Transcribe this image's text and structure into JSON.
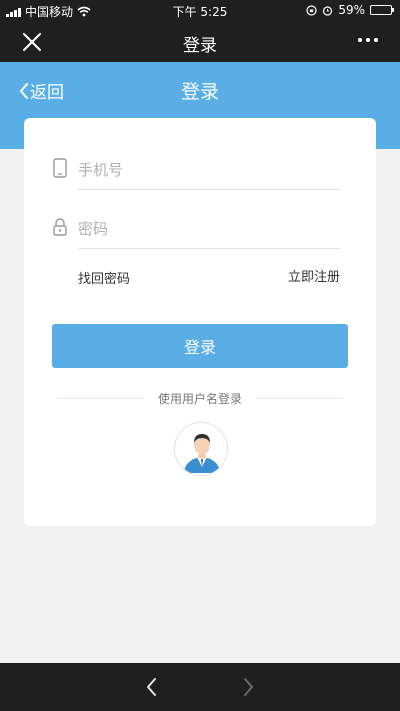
{
  "status_bar": {
    "carrier": "中国移动",
    "time": "下午 5:25",
    "battery_percent": "59%",
    "battery_level": 0.59
  },
  "wechat_bar": {
    "title": "登录",
    "close_icon": "close-icon",
    "more_icon": "more-icon"
  },
  "header": {
    "back_label": "返回",
    "title": "登录",
    "color": "#5aaee6"
  },
  "form": {
    "phone_placeholder": "手机号",
    "password_placeholder": "密码",
    "forgot_password": "找回密码",
    "register": "立即注册",
    "login_button": "登录",
    "alt_login_text": "使用用户名登录"
  },
  "colors": {
    "accent": "#5aaee6",
    "dark_bar": "#1f1f1f",
    "background": "#f2f2f2"
  }
}
